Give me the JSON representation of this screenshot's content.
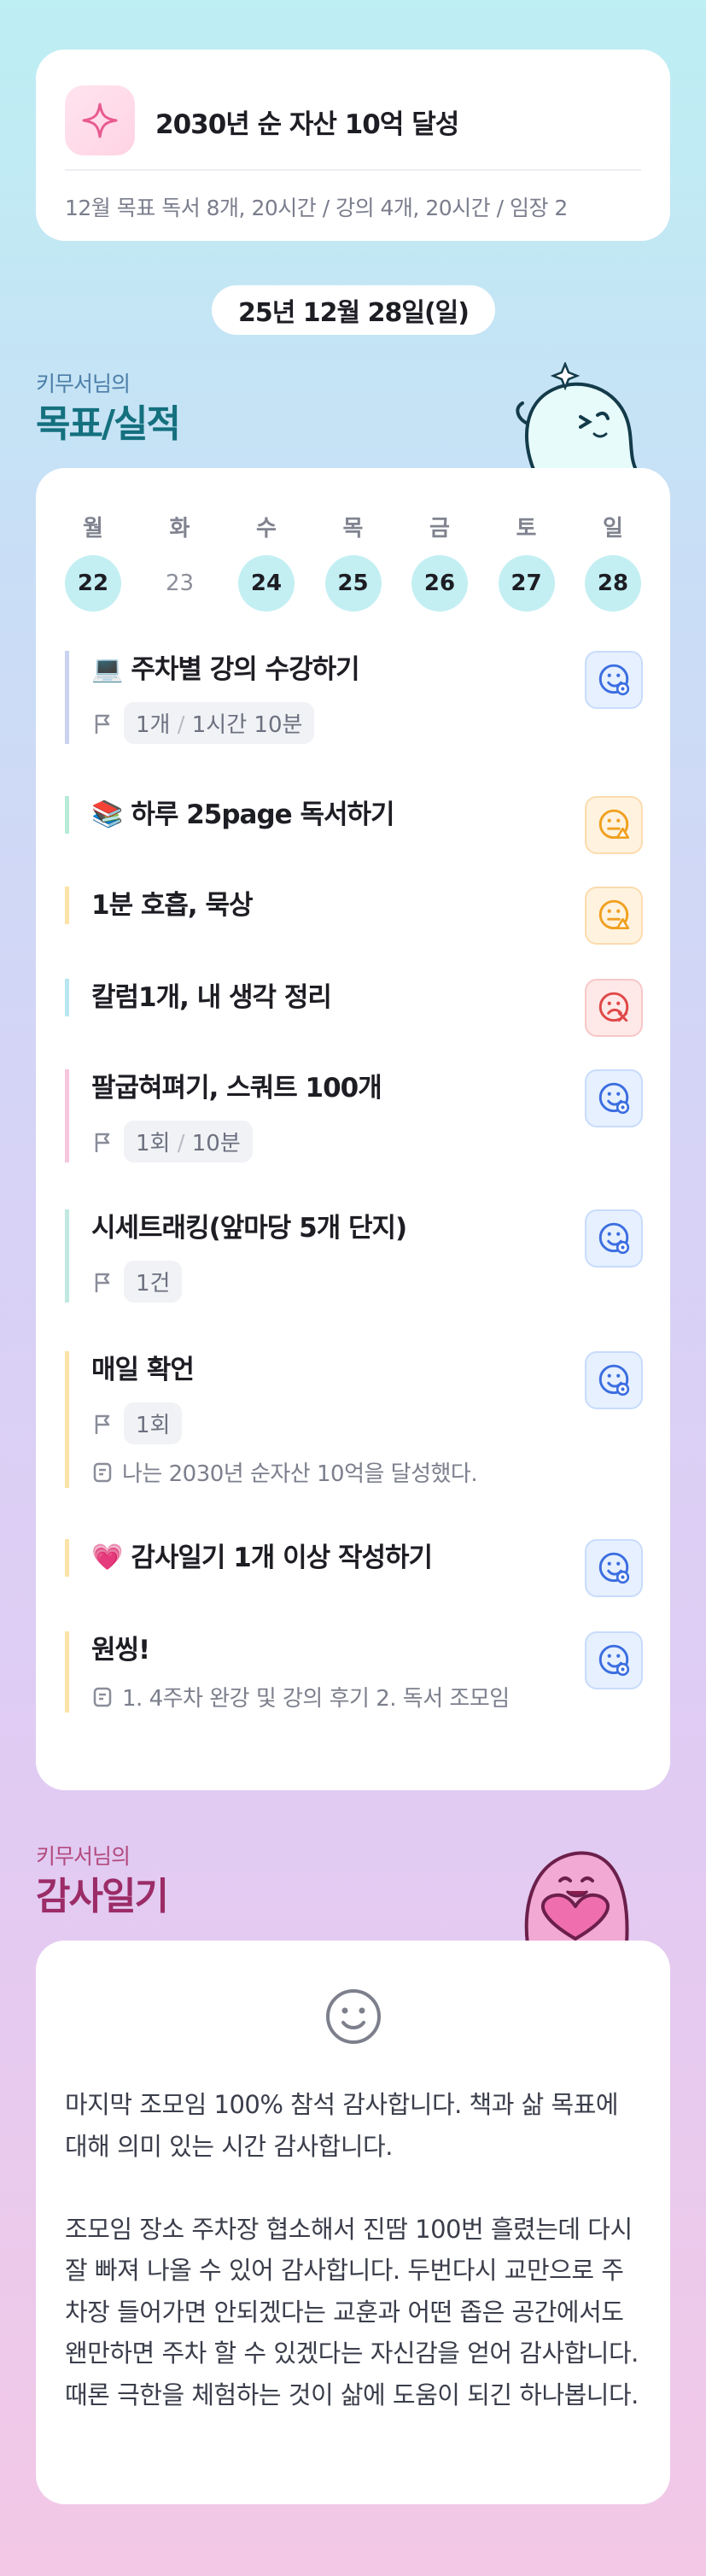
{
  "goal": {
    "title": "2030년 순 자산 10억 달성",
    "subtitle": "12월 목표  독서 8개, 20시간 / 강의 4개, 20시간 / 임장 2"
  },
  "date": "25년 12월 28일(일)",
  "section_goals": {
    "small": "키무서님의",
    "big": "목표/실적"
  },
  "section_diary": {
    "small": "키무서님의",
    "big": "감사일기"
  },
  "week": [
    {
      "name": "월",
      "num": "22",
      "active": true
    },
    {
      "name": "화",
      "num": "23",
      "active": false
    },
    {
      "name": "수",
      "num": "24",
      "active": true
    },
    {
      "name": "목",
      "num": "25",
      "active": true
    },
    {
      "name": "금",
      "num": "26",
      "active": true
    },
    {
      "name": "토",
      "num": "27",
      "active": true
    },
    {
      "name": "일",
      "num": "28",
      "active": true
    }
  ],
  "tasks": [
    {
      "emoji": "💻",
      "title": "주차별 강의 수강하기",
      "chip_a": "1개",
      "chip_b": "1시간 10분",
      "status": "good",
      "bar": "#c9d3f0"
    },
    {
      "emoji": "📚",
      "title": "하루 25page 독서하기",
      "status": "mid",
      "bar": "#b7ead7"
    },
    {
      "title": "1분 호흡, 묵상",
      "status": "mid",
      "bar": "#fbe2a6"
    },
    {
      "title": "칼럼1개, 내 생각 정리",
      "status": "bad",
      "bar": "#b8e7f0"
    },
    {
      "title": "팔굽혀펴기, 스쿼트 100개",
      "chip_a": "1회",
      "chip_b": "10분",
      "status": "good",
      "bar": "#f6c6dc"
    },
    {
      "title": "시세트래킹(앞마당 5개 단지)",
      "chip_a": "1건",
      "status": "good",
      "bar": "#bfe9e1"
    },
    {
      "title": "매일 확언",
      "chip_a": "1회",
      "note": "나는 2030년 순자산 10억을 달성했다.",
      "status": "good",
      "bar": "#fbe2a6"
    },
    {
      "emoji": "💗",
      "title": "감사일기 1개 이상 작성하기",
      "status": "good",
      "bar": "#fbe2a6"
    },
    {
      "title": "원씽!",
      "note": "1. 4주차 완강 및 강의 후기 2. 독서 조모임",
      "status": "good",
      "bar": "#fbe2a6"
    }
  ],
  "diary": {
    "text": "마지막 조모임 100% 참석 감사합니다. 책과 삶 목표에 대해 의미 있는 시간 감사합니다.\n\n조모임 장소 주차장 협소해서 진땀 100번 흘렸는데 다시 잘 빠져 나올 수 있어 감사합니다. 두번다시 교만으로 주차장 들어가면 안되겠다는 교훈과 어떤 좁은 공간에서도 왠만하면 주차 할 수 있겠다는 자신감을 얻어 감사합니다. 때론 극한을 체험하는 것이 삶에 도움이 되긴 하나봅니다."
  },
  "colors": {
    "accent_cyan": "#c3eff3",
    "status_good": "#3c6ee0",
    "status_mid": "#f0a020",
    "status_bad": "#e04848"
  }
}
